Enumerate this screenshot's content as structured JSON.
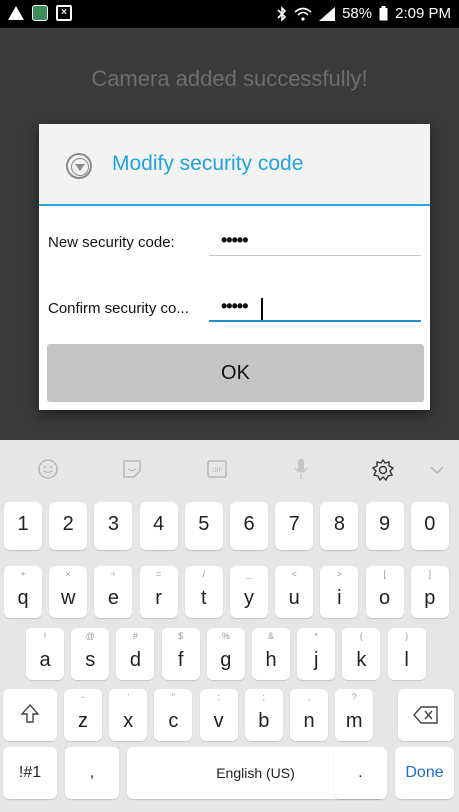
{
  "status_bar": {
    "battery": "58%",
    "time": "2:09 PM",
    "icons": [
      "warning-icon",
      "app-icon",
      "close-box-icon",
      "bluetooth-icon",
      "wifi-icon",
      "signal-icon",
      "battery-icon"
    ]
  },
  "background": {
    "title": "Camera added successfully!"
  },
  "dialog": {
    "title": "Modify security code",
    "new_label": "New security code:",
    "new_value": "•••••",
    "confirm_label": "Confirm security co...",
    "confirm_value": "•••••",
    "ok_label": "OK"
  },
  "keyboard": {
    "toolbar_icons": [
      "emoji-icon",
      "sticker-icon",
      "gif-icon",
      "microphone-icon",
      "settings-icon",
      "chevron-down-icon"
    ],
    "numbers": [
      "1",
      "2",
      "3",
      "4",
      "5",
      "6",
      "7",
      "8",
      "9",
      "0"
    ],
    "row1": [
      [
        "q",
        "+"
      ],
      [
        "w",
        "×"
      ],
      [
        "e",
        "÷"
      ],
      [
        "r",
        "="
      ],
      [
        "t",
        "/"
      ],
      [
        "y",
        "_"
      ],
      [
        "u",
        "<"
      ],
      [
        "i",
        ">"
      ],
      [
        "o",
        "["
      ],
      [
        "p",
        "]"
      ]
    ],
    "row2": [
      [
        "a",
        "!"
      ],
      [
        "s",
        "@"
      ],
      [
        "d",
        "#"
      ],
      [
        "f",
        "$"
      ],
      [
        "g",
        "%"
      ],
      [
        "h",
        "&"
      ],
      [
        "j",
        "*"
      ],
      [
        "k",
        "("
      ],
      [
        "l",
        ")"
      ]
    ],
    "row3": [
      [
        "z",
        "-"
      ],
      [
        "x",
        "'"
      ],
      [
        "c",
        "\""
      ],
      [
        "v",
        ":"
      ],
      [
        "b",
        ";"
      ],
      [
        "n",
        ","
      ],
      [
        "m",
        "?"
      ]
    ],
    "shift_icon": "shift-icon",
    "backspace_icon": "backspace-icon",
    "symbols_label": "!#1",
    "comma": ",",
    "space_label": "English (US)",
    "period": ".",
    "done_label": "Done",
    "colors": {
      "accent": "#29a7dd",
      "done": "#1e6fd0"
    }
  }
}
